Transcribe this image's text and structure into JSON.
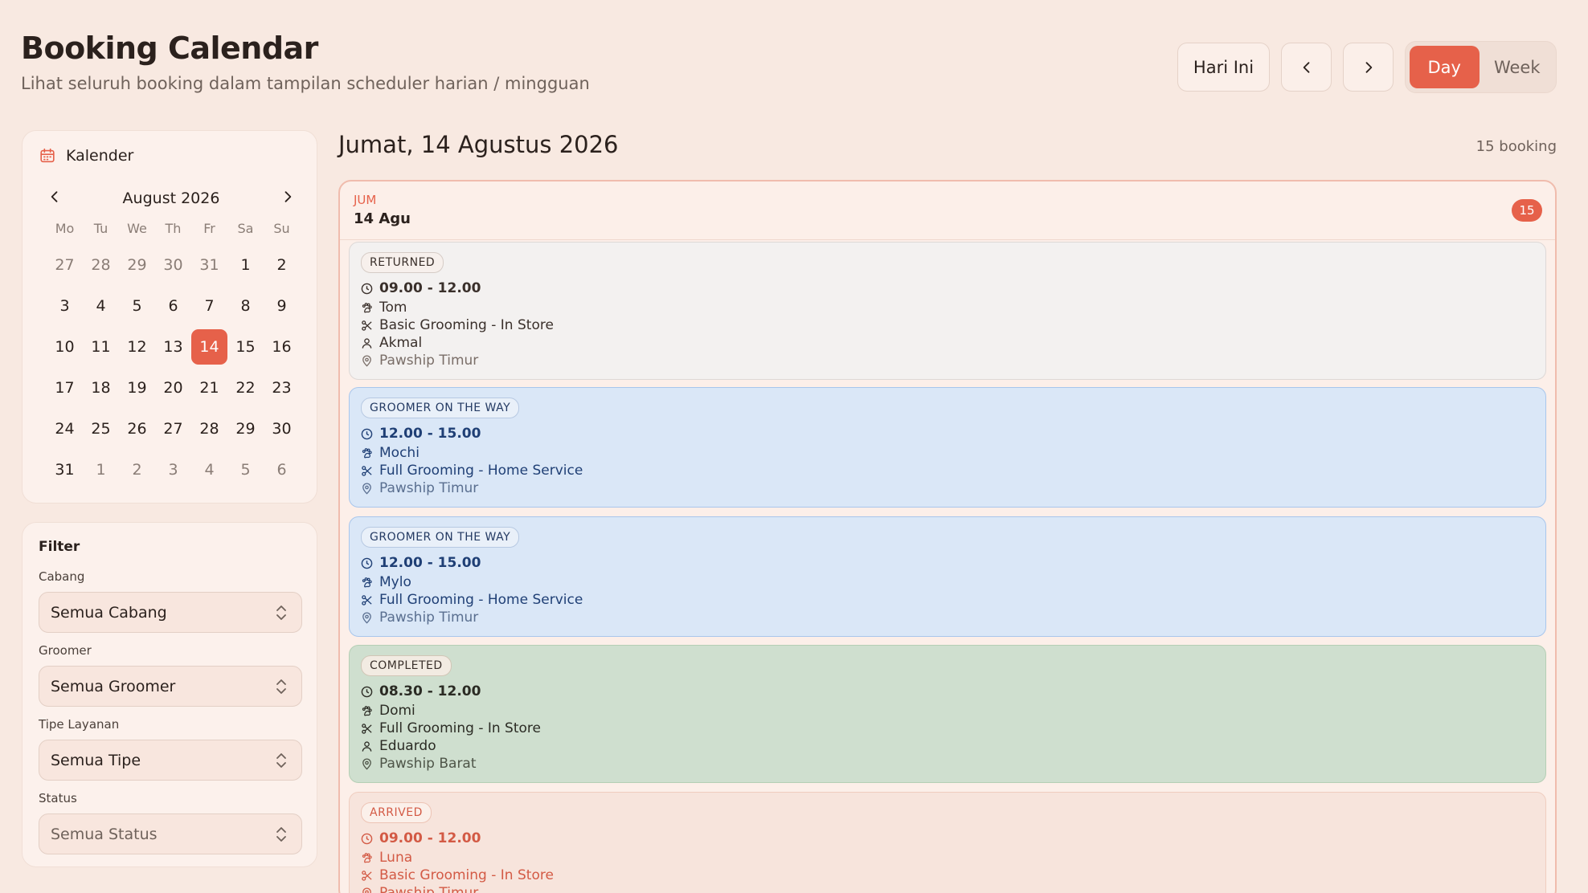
{
  "header": {
    "title": "Booking Calendar",
    "subtitle": "Lihat seluruh booking dalam tampilan scheduler harian / mingguan",
    "today_label": "Hari Ini",
    "view_day": "Day",
    "view_week": "Week",
    "prev_icon": "chevron-left-icon",
    "next_icon": "chevron-right-icon"
  },
  "calendar": {
    "title": "Kalender",
    "month_label": "August 2026",
    "dow": [
      "Mo",
      "Tu",
      "We",
      "Th",
      "Fr",
      "Sa",
      "Su"
    ],
    "weeks": [
      [
        "27",
        "28",
        "29",
        "30",
        "31",
        "1",
        "2"
      ],
      [
        "3",
        "4",
        "5",
        "6",
        "7",
        "8",
        "9"
      ],
      [
        "10",
        "11",
        "12",
        "13",
        "14",
        "15",
        "16"
      ],
      [
        "17",
        "18",
        "19",
        "20",
        "21",
        "22",
        "23"
      ],
      [
        "24",
        "25",
        "26",
        "27",
        "28",
        "29",
        "30"
      ],
      [
        "31",
        "1",
        "2",
        "3",
        "4",
        "5",
        "6"
      ]
    ]
  },
  "filter": {
    "title": "Filter",
    "groups": [
      {
        "label": "Cabang",
        "value": "Semua Cabang"
      },
      {
        "label": "Groomer",
        "value": "Semua Groomer"
      },
      {
        "label": "Tipe Layanan",
        "value": "Semua Tipe"
      },
      {
        "label": "Status",
        "value": "Semua Status"
      }
    ]
  },
  "main": {
    "date_title": "Jumat, 14 Agustus 2026",
    "booking_count": "15 booking",
    "day_dow": "JUM",
    "day_date": "14 Agu",
    "day_badge": "15"
  },
  "bookings": [
    {
      "status": "RETURNED",
      "time": "09.00 - 12.00",
      "pet": "Tom",
      "service": "Basic Grooming - In Store",
      "groomer": "Akmal",
      "branch": "Pawship Timur"
    },
    {
      "status": "GROOMER ON THE WAY",
      "time": "12.00 - 15.00",
      "pet": "Mochi",
      "service": "Full Grooming - Home Service",
      "branch": "Pawship Timur"
    },
    {
      "status": "GROOMER ON THE WAY",
      "time": "12.00 - 15.00",
      "pet": "Mylo",
      "service": "Full Grooming - Home Service",
      "branch": "Pawship Timur"
    },
    {
      "status": "COMPLETED",
      "time": "08.30 - 12.00",
      "pet": "Domi",
      "service": "Full Grooming - In Store",
      "groomer": "Eduardo",
      "branch": "Pawship Barat"
    },
    {
      "status": "ARRIVED",
      "time": "09.00 - 12.00",
      "pet": "Luna",
      "service": "Basic Grooming - In Store",
      "branch": "Pawship Timur"
    }
  ],
  "colors": {
    "accent": "#e6614a",
    "background": "#f8e9e1"
  }
}
